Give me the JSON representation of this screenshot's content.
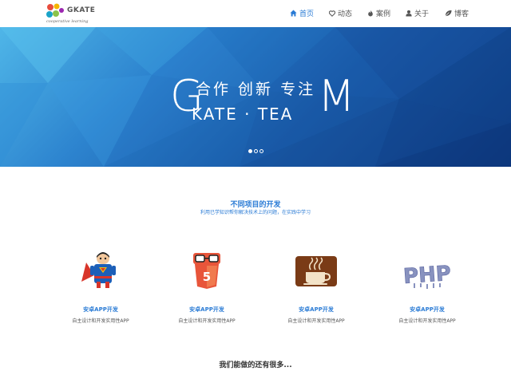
{
  "logo": {
    "name": "GKATE",
    "tagline": "cooperative learning"
  },
  "nav": {
    "items": [
      {
        "label": "首页",
        "icon": "home-icon",
        "active": true
      },
      {
        "label": "动态",
        "icon": "heart-icon",
        "active": false
      },
      {
        "label": "案例",
        "icon": "fire-icon",
        "active": false
      },
      {
        "label": "关于",
        "icon": "user-icon",
        "active": false
      },
      {
        "label": "博客",
        "icon": "leaf-icon",
        "active": false
      }
    ]
  },
  "banner": {
    "letter_left": "G",
    "letter_right": "M",
    "slogan": "合作 创新 专注",
    "team": "KATE · TEA",
    "slides": 3,
    "active_slide": 1
  },
  "services": {
    "title": "不同项目的开发",
    "subtitle": "利用已学知识帮你解决技术上的问题，在实践中学习",
    "cards": [
      {
        "icon": "android-superman-icon",
        "title": "安卓APP开发",
        "desc": "自主设计和开发实用性APP"
      },
      {
        "icon": "html5-icon",
        "title": "安卓APP开发",
        "desc": "自主设计和开发实用性APP"
      },
      {
        "icon": "java-coffee-icon",
        "title": "安卓APP开发",
        "desc": "自主设计和开发实用性APP"
      },
      {
        "icon": "php-icon",
        "title": "安卓APP开发",
        "desc": "自主设计和开发实用性APP"
      }
    ]
  },
  "more": {
    "title": "我们能做的还有很多..."
  },
  "colors": {
    "accent": "#2a7bd5",
    "banner_dark": "#0e3a80",
    "banner_light": "#4fb6e8"
  }
}
